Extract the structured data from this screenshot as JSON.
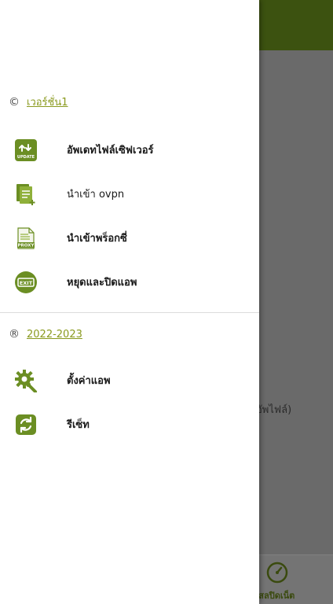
{
  "background": {
    "partial_text": "อัพไฟล์)",
    "bottom_tab_label": "ทสลปิดเน็ต",
    "bottom_tab_icon": "speedometer-icon"
  },
  "drawer": {
    "version_section": {
      "symbol": "©",
      "link_text": "เวอร์ชั่น1"
    },
    "items": [
      {
        "icon": "update-icon",
        "label": "อัพเดทไฟล์เซิฟเวอร์"
      },
      {
        "icon": "import-file-icon",
        "label": "นำเข้า ovpn"
      },
      {
        "icon": "proxy-icon",
        "label": "นำเข้าพร็อกซี่"
      },
      {
        "icon": "exit-icon",
        "label": "หยุดและปิดแอพ"
      }
    ],
    "year_section": {
      "symbol": "®",
      "link_text": "2022-2023"
    },
    "items2": [
      {
        "icon": "settings-icon",
        "label": "ตั้งค่าแอพ"
      },
      {
        "icon": "reset-icon",
        "label": "รีเซ็ท"
      }
    ]
  },
  "colors": {
    "accent": "#6b8e23",
    "header": "#3c5210",
    "link": "#8a9a1e"
  }
}
